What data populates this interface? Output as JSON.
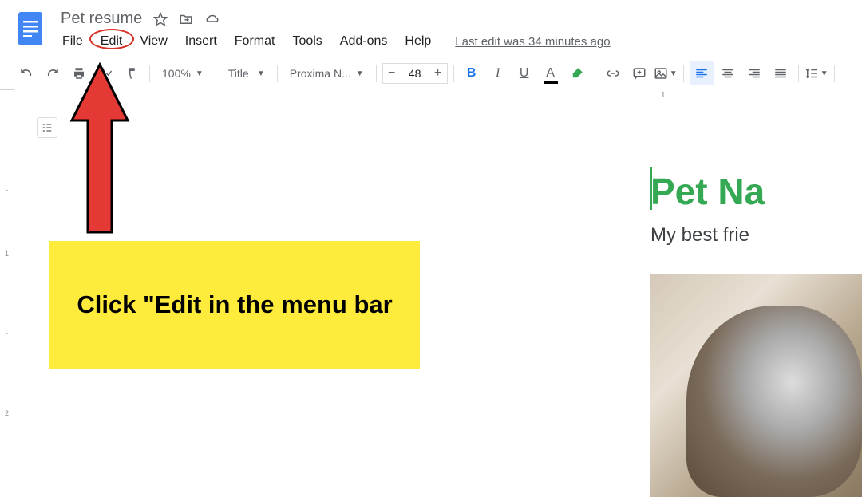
{
  "header": {
    "doc_title": "Pet resume",
    "menus": [
      "File",
      "Edit",
      "View",
      "Insert",
      "Format",
      "Tools",
      "Add-ons",
      "Help"
    ],
    "last_edit": "Last edit was 34 minutes ago"
  },
  "toolbar": {
    "zoom": "100%",
    "style": "Title",
    "font": "Proxima N...",
    "font_size": "48"
  },
  "document": {
    "heading": "Pet Na",
    "subtitle": "My best frie"
  },
  "annotation": {
    "text": "Click \"Edit in the menu bar"
  },
  "ruler": {
    "h_start": "1"
  }
}
